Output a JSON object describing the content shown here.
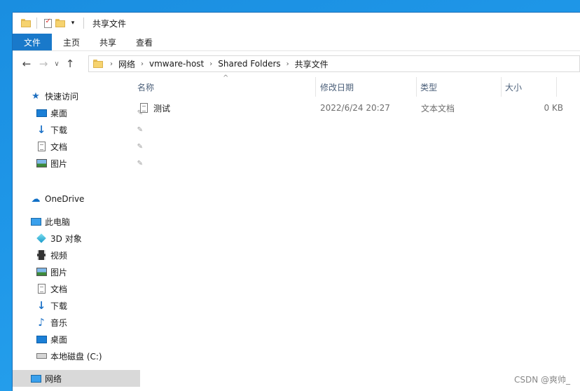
{
  "window": {
    "title": "共享文件"
  },
  "ribbon": {
    "tabs": [
      "文件",
      "主页",
      "共享",
      "查看"
    ]
  },
  "address": {
    "crumbs": [
      "网络",
      "vmware-host",
      "Shared Folders",
      "共享文件"
    ]
  },
  "nav": {
    "quick_access": "快速访问",
    "quick_items": [
      "桌面",
      "下载",
      "文档",
      "图片"
    ],
    "onedrive": "OneDrive",
    "this_pc": "此电脑",
    "pc_items": [
      "3D 对象",
      "视频",
      "图片",
      "文档",
      "下载",
      "音乐",
      "桌面",
      "本地磁盘 (C:)"
    ],
    "network": "网络"
  },
  "columns": {
    "name": "名称",
    "date": "修改日期",
    "type": "类型",
    "size": "大小"
  },
  "files": [
    {
      "name": "测试",
      "date": "2022/6/24 20:27",
      "type": "文本文档",
      "size": "0 KB"
    }
  ],
  "watermark": "CSDN @爽帅_"
}
